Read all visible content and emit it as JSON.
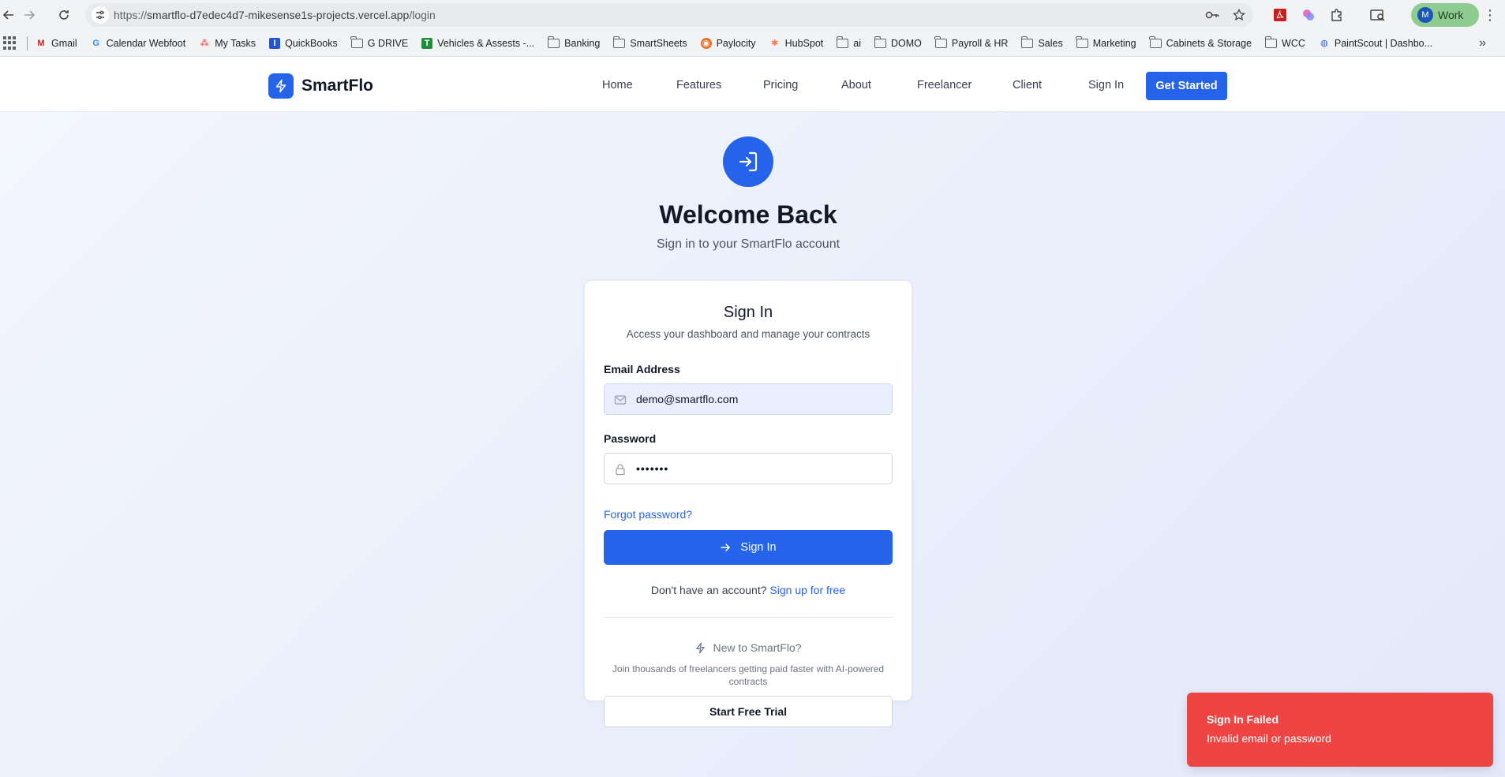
{
  "browser": {
    "url_prefix": "https://",
    "url_main": "smartflo-d7edec4d7-mikesense1s-projects.vercel.app",
    "url_path": "/login",
    "profile_initial": "M",
    "profile_label": "Work",
    "bookmarks": [
      {
        "label": "Gmail",
        "icon": "gmail-icon"
      },
      {
        "label": "Calendar Webfoot",
        "icon": "google-icon"
      },
      {
        "label": "My Tasks",
        "icon": "asana-icon"
      },
      {
        "label": "QuickBooks",
        "icon": "quickbooks-icon"
      },
      {
        "label": "G DRIVE",
        "icon": "folder-icon"
      },
      {
        "label": "Vehicles & Assests -...",
        "icon": "sheets-icon"
      },
      {
        "label": "Banking",
        "icon": "folder-icon"
      },
      {
        "label": "SmartSheets",
        "icon": "folder-icon"
      },
      {
        "label": "Paylocity",
        "icon": "paylocity-icon"
      },
      {
        "label": "HubSpot",
        "icon": "hubspot-icon"
      },
      {
        "label": "ai",
        "icon": "folder-icon"
      },
      {
        "label": "DOMO",
        "icon": "folder-icon"
      },
      {
        "label": "Payroll & HR",
        "icon": "folder-icon"
      },
      {
        "label": "Sales",
        "icon": "folder-icon"
      },
      {
        "label": "Marketing",
        "icon": "folder-icon"
      },
      {
        "label": "Cabinets & Storage",
        "icon": "folder-icon"
      },
      {
        "label": "WCC",
        "icon": "folder-icon"
      },
      {
        "label": "PaintScout | Dashbo...",
        "icon": "paintscout-icon"
      }
    ]
  },
  "header": {
    "brand": "SmartFlo",
    "nav": [
      "Home",
      "Features",
      "Pricing",
      "About",
      "Freelancer",
      "Client",
      "Sign In"
    ],
    "cta": "Get Started"
  },
  "hero": {
    "title": "Welcome Back",
    "subtitle": "Sign in to your SmartFlo account"
  },
  "form": {
    "title": "Sign In",
    "subtitle": "Access your dashboard and manage your contracts",
    "email_label": "Email Address",
    "email_value": "demo@smartflo.com",
    "password_label": "Password",
    "password_value": "•••••••",
    "forgot": "Forgot password?",
    "submit": "Sign In",
    "no_account": "Don't have an account?",
    "signup": "Sign up for free",
    "new_to": "New to SmartFlo?",
    "join": "Join thousands of freelancers getting paid faster with AI-powered contracts",
    "trial": "Start Free Trial"
  },
  "toast": {
    "title": "Sign In Failed",
    "message": "Invalid email or password"
  },
  "colors": {
    "primary": "#2563eb",
    "error": "#ef4444"
  }
}
